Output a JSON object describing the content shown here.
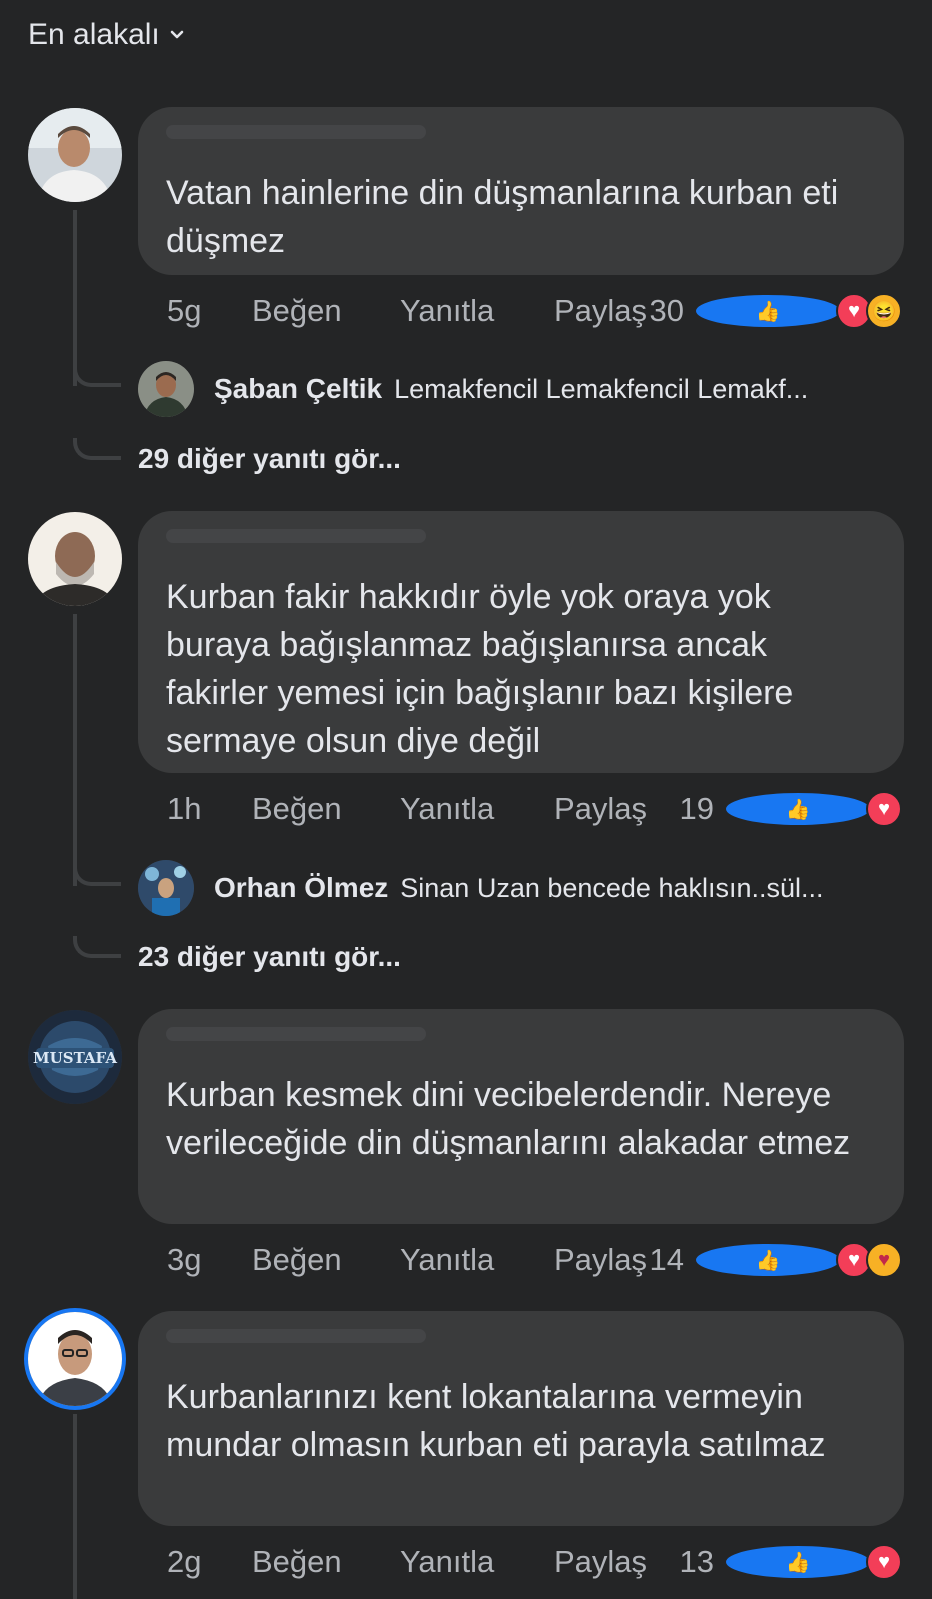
{
  "sort": {
    "label": "En alakalı"
  },
  "comments": [
    {
      "text": "Vatan hainlerine din düşmanlarına kurban eti düşmez",
      "time": "5g",
      "like": "Beğen",
      "reply": "Yanıtla",
      "share": "Paylaş",
      "reaction_count": "30",
      "reactions": [
        "like-icon",
        "love-icon",
        "haha-icon"
      ],
      "top_reply": {
        "name": "Şaban Çeltik",
        "text": "Lemakfencil Lemakfencil Lemakf..."
      },
      "more_replies": "29 diğer yanıtı gör..."
    },
    {
      "text": "Kurban fakir hakkıdır öyle yok oraya yok buraya bağışlanmaz bağışlanırsa ancak fakirler yemesi için bağışlanır bazı kişilere sermaye olsun diye değil",
      "time": "1h",
      "like": "Beğen",
      "reply": "Yanıtla",
      "share": "Paylaş",
      "reaction_count": "19",
      "reactions": [
        "like-icon",
        "love-icon"
      ],
      "top_reply": {
        "name": "Orhan Ölmez",
        "text": "Sinan Uzan bencede haklısın..sül..."
      },
      "more_replies": "23 diğer yanıtı gör..."
    },
    {
      "text": "Kurban kesmek dini vecibelerdendir. Nereye verileceğide din düşmanlarını alakadar etmez",
      "time": "3g",
      "like": "Beğen",
      "reply": "Yanıtla",
      "share": "Paylaş",
      "reaction_count": "14",
      "reactions": [
        "like-icon",
        "love-icon",
        "care-icon"
      ],
      "avatar_text": "MUSTAFA"
    },
    {
      "text": "Kurbanlarınızı kent lokantalarına vermeyin mundar olmasın kurban eti parayla satılmaz",
      "time": "2g",
      "like": "Beğen",
      "reply": "Yanıtla",
      "share": "Paylaş",
      "reaction_count": "13",
      "reactions": [
        "like-icon",
        "love-icon"
      ]
    }
  ],
  "colors": {
    "background": "#242526",
    "bubble": "#3a3b3c",
    "like": "#1877f2",
    "love": "#f33e58"
  }
}
